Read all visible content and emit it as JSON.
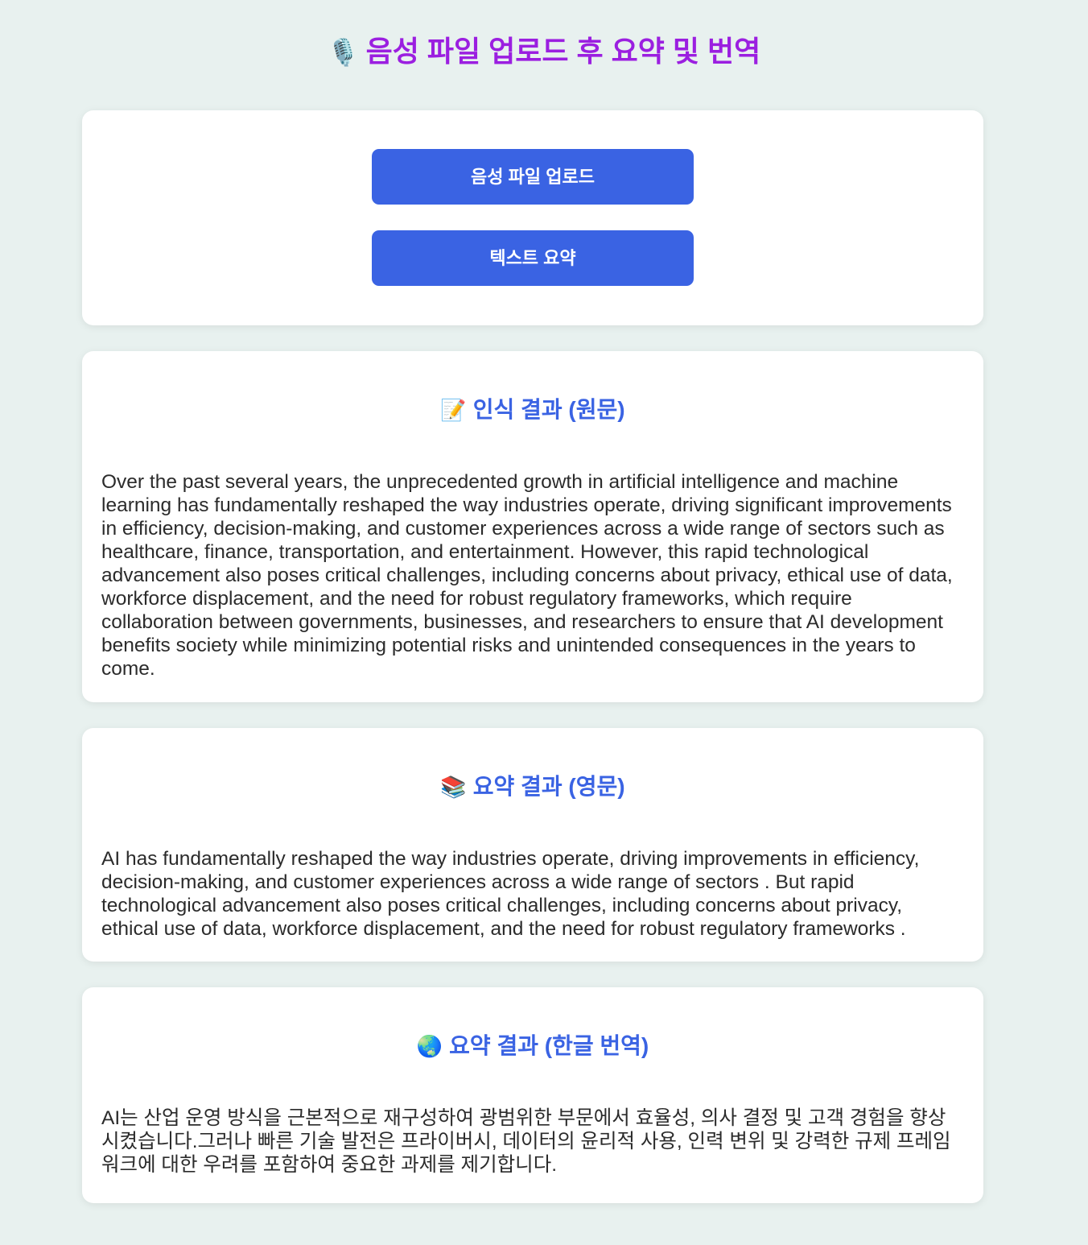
{
  "header": {
    "icon": "microphone-icon",
    "icon_glyph": "🎙️",
    "title": "음성 파일 업로드 후 요약 및 번역"
  },
  "controls": {
    "upload_label": "음성 파일 업로드",
    "summarize_label": "텍스트 요약"
  },
  "sections": {
    "original": {
      "icon": "memo-icon",
      "icon_glyph": "📝",
      "heading": "인식 결과 (원문)",
      "text": "Over the past several years, the unprecedented growth in artificial intelligence and machine learning has fundamentally reshaped the way industries operate, driving significant improvements in efficiency, decision-making, and customer experiences across a wide range of sectors such as healthcare, finance, transportation, and entertainment. However, this rapid technological advancement also poses critical challenges, including concerns about privacy, ethical use of data, workforce displacement, and the need for robust regulatory frameworks, which require collaboration between governments, businesses, and researchers to ensure that AI development benefits society while minimizing potential risks and unintended consequences in the years to come."
    },
    "summary_en": {
      "icon": "books-icon",
      "icon_glyph": "📚",
      "heading": "요약 결과 (영문)",
      "text": "AI has fundamentally reshaped the way industries operate, driving improvements in efficiency, decision-making, and customer experiences across a wide range of sectors . But rapid technological advancement also poses critical challenges, including concerns about privacy, ethical use of data, workforce displacement, and the need for robust regulatory frameworks ."
    },
    "summary_ko": {
      "icon": "globe-icon",
      "icon_glyph": "🌏",
      "heading": "요약 결과 (한글 번역)",
      "text": "AI는 산업 운영 방식을 근본적으로 재구성하여 광범위한 부문에서 효율성, 의사 결정 및 고객 경험을 향상 시켰습니다.그러나 빠른 기술 발전은 프라이버시, 데이터의 윤리적 사용, 인력 변위 및 강력한 규제 프레임 워크에 대한 우려를 포함하여 중요한 과제를 제기합니다."
    }
  },
  "colors": {
    "background": "#e8f1ef",
    "title": "#9b1fe0",
    "accent": "#3a63e3",
    "card": "#ffffff",
    "text": "#2b2b2b"
  }
}
